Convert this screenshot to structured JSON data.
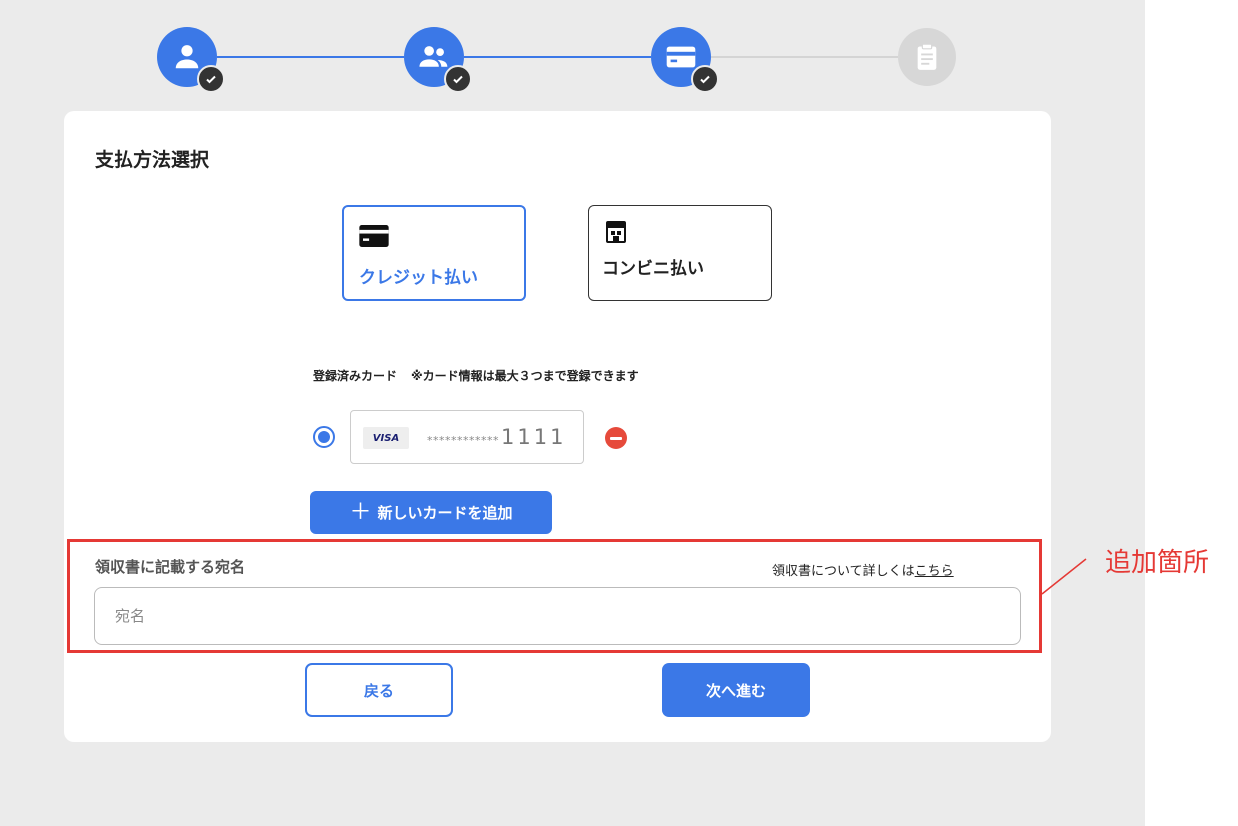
{
  "stepper": {
    "steps": [
      {
        "icon": "person-icon",
        "state": "completed"
      },
      {
        "icon": "group-icon",
        "state": "completed"
      },
      {
        "icon": "credit-card-icon",
        "state": "completed"
      },
      {
        "icon": "clipboard-icon",
        "state": "pending"
      }
    ]
  },
  "section": {
    "title": "支払方法選択"
  },
  "payment_methods": [
    {
      "label": "クレジット払い",
      "icon": "credit-card-icon",
      "selected": true
    },
    {
      "label": "コンビニ払い",
      "icon": "store-icon",
      "selected": false
    }
  ],
  "registered_cards": {
    "heading": "登録済みカード",
    "note": "※カード情報は最大３つまで登録できます",
    "items": [
      {
        "brand": "VISA",
        "masked": "************",
        "last4": "1111",
        "selected": true
      }
    ]
  },
  "add_card": {
    "label": "新しいカードを追加"
  },
  "receipt": {
    "label": "領収書に記載する宛名",
    "help_text": "領収書について詳しくは",
    "help_link": "こちら",
    "placeholder": "宛名",
    "value": ""
  },
  "actions": {
    "back": "戻る",
    "next": "次へ進む"
  },
  "annotation": {
    "text": "追加箇所"
  },
  "colors": {
    "accent": "#3b78e7",
    "annotation": "#e53935",
    "remove": "#e64a3b",
    "page_bg": "#ebebeb",
    "step_pending": "#d7d7d7"
  }
}
